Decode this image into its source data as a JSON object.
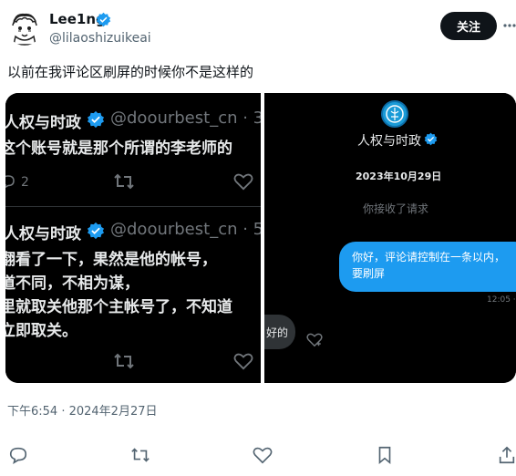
{
  "author": {
    "display_name": "Lee1ng",
    "handle": "@lilaoshizuikeai"
  },
  "follow_label": "关注",
  "tweet_text": "以前在我评论区刷屏的时候你不是这样的",
  "timestamp": "下午6:54 · 2024年2月27日",
  "media": {
    "left_panel": {
      "post1": {
        "name": "人权与时政",
        "handle": "@doourbest_cn · 3",
        "text": "这个账号就是那个所谓的李老师的",
        "reply_count": "2"
      },
      "post2": {
        "name": "人权与时政",
        "handle": "@doourbest_cn · 5",
        "lines": [
          "翻看了一下，果然是他的帐号，",
          "道不同，不相为谋，",
          "里就取关他那个主帐号了，不知道",
          "立即取关。"
        ]
      }
    },
    "right_panel": {
      "profile_name": "人权与时政",
      "date": "2023年10月29日",
      "accepted_request": "你接收了请求",
      "message_lines": [
        "你好，评论请控制在一条以内，",
        "要刷屏"
      ],
      "message_time": "12:05 · E",
      "partial_text": "好的"
    }
  },
  "icons": {
    "more": "more-icon",
    "verified": "verified-badge-icon",
    "reply": "reply-icon",
    "retweet": "retweet-icon",
    "like": "like-icon",
    "bookmark": "bookmark-icon",
    "share": "share-icon"
  },
  "colors": {
    "verified_blue": "#1d9bf0",
    "text_primary": "#0f1419",
    "text_secondary": "#536471",
    "button_dark": "#0f1419"
  }
}
